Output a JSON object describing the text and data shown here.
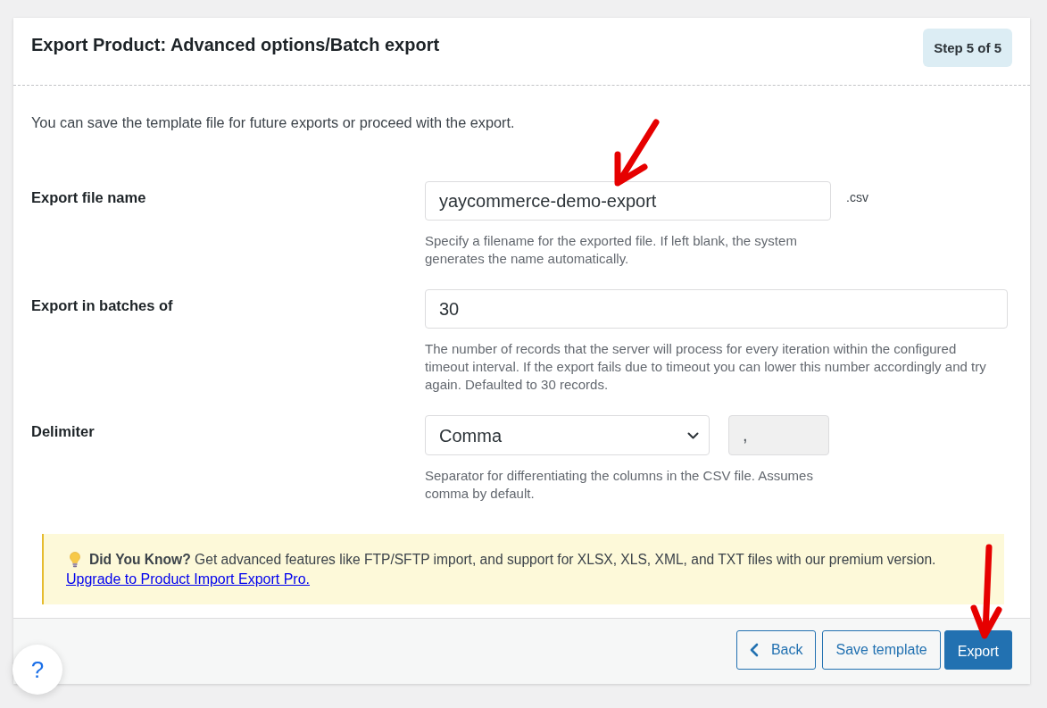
{
  "header": {
    "title": "Export Product: Advanced options/Batch export",
    "step": "Step 5 of 5"
  },
  "intro": "You can save the template file for future exports or proceed with the export.",
  "fields": [
    {
      "kind": "text",
      "label": "Export file name",
      "value": "yaycommerce-demo-export",
      "suffix": ".csv",
      "help": "Specify a filename for the exported file. If left blank, the system generates the name automatically."
    },
    {
      "kind": "number",
      "label": "Export in batches of",
      "value": "30",
      "help": "The number of records that the server will process for every iteration within the configured timeout interval. If the export fails due to timeout you can lower this number accordingly and try again. Defaulted to 30 records."
    },
    {
      "kind": "select",
      "label": "Delimiter",
      "value": "Comma",
      "character": {
        "value": ",",
        "disabled": true
      },
      "help": "Separator for differentiating the columns in the CSV file. Assumes comma by default."
    }
  ],
  "notice": {
    "text": "**Did You Know?** Get advanced features like FTP/SFTP import, and support for XLSX, XLS, XML, and TXT files with our premium version.",
    "link": "Upgrade to Product Import Export Pro."
  },
  "footer_buttons": [
    {
      "kind": "back",
      "label": "Back"
    },
    {
      "kind": "secondary",
      "label": "Save template"
    },
    {
      "kind": "primary",
      "label": "Export"
    }
  ],
  "help_button": {
    "label": "?"
  }
}
